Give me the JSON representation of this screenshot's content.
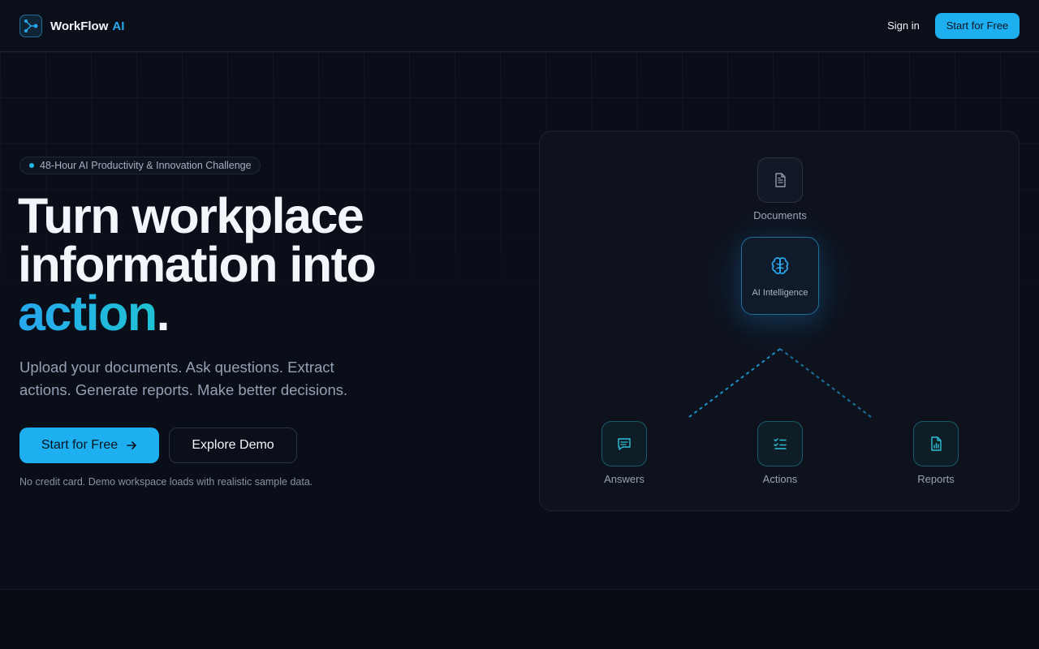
{
  "nav": {
    "brand_name": "WorkFlow",
    "brand_accent": "AI",
    "signin_label": "Sign in",
    "cta_label": "Start for Free"
  },
  "hero": {
    "badge_text": "48-Hour AI Productivity & Innovation Challenge",
    "headline_line1": "Turn workplace",
    "headline_line2": "information into",
    "headline_accent": "action",
    "headline_period": ".",
    "subhead": "Upload your documents. Ask questions. Extract actions. Generate reports. Make better decisions.",
    "primary_button": "Start for Free",
    "secondary_button": "Explore Demo",
    "fineprint": "No credit card. Demo workspace loads with realistic sample data."
  },
  "diagram": {
    "top_node": {
      "label": "Documents",
      "icon": "document-icon"
    },
    "core_node": {
      "label": "AI Intelligence",
      "icon": "brain-icon"
    },
    "bottom_nodes": [
      {
        "label": "Answers",
        "icon": "message-icon"
      },
      {
        "label": "Actions",
        "icon": "checklist-icon"
      },
      {
        "label": "Reports",
        "icon": "report-chart-icon"
      }
    ]
  },
  "colors": {
    "background": "#0a0e18",
    "accent": "#1daff0",
    "teal": "#1ec3d3",
    "muted_text": "#94a0b3"
  }
}
